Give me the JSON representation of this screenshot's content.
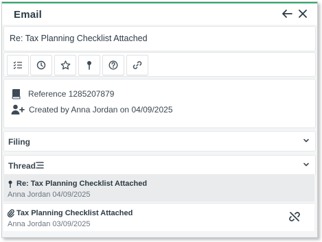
{
  "header": {
    "title": "Email"
  },
  "subject": "Re: Tax Planning Checklist Attached",
  "toolbar": {
    "buttons": [
      {
        "icon": "list-check-icon"
      },
      {
        "icon": "clock-icon"
      },
      {
        "icon": "star-icon"
      },
      {
        "icon": "pin-icon"
      },
      {
        "icon": "help-icon"
      },
      {
        "icon": "link-icon"
      }
    ]
  },
  "info": {
    "reference": "Reference 1285207879",
    "created": "Created by Anna Jordan on 04/09/2025"
  },
  "sections": {
    "filing": "Filing",
    "thread": "Thread"
  },
  "thread": [
    {
      "subject": "Re: Tax Planning Checklist Attached",
      "meta": "Anna Jordan 04/09/2025",
      "selected": true
    },
    {
      "subject": "Tax Planning Checklist Attached",
      "meta": "Anna Jordan 03/09/2025",
      "selected": false
    }
  ],
  "colors": {
    "accent": "#2fa86a",
    "text": "#2d3a45",
    "icon": "#3e4b56",
    "selected_bg": "#e9ebed",
    "background": "#f4f5f6"
  }
}
